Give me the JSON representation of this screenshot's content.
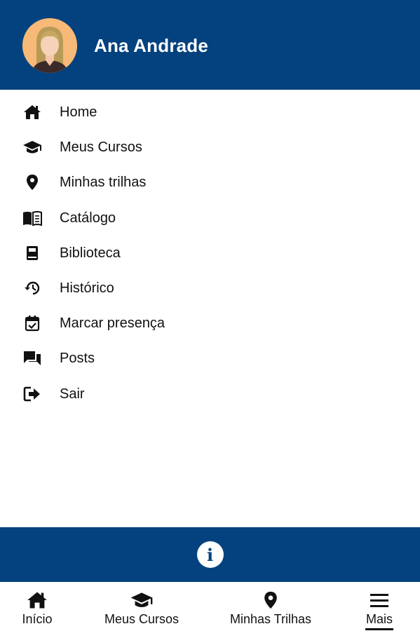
{
  "header": {
    "user_name": "Ana Andrade",
    "background_color": "#03427e",
    "avatar": "avatar-woman-blonde"
  },
  "menu": {
    "items": [
      {
        "label": "Home",
        "icon": "home-icon"
      },
      {
        "label": "Meus Cursos",
        "icon": "graduation-cap-icon"
      },
      {
        "label": "Minhas trilhas",
        "icon": "map-pin-icon"
      },
      {
        "label": "Catálogo",
        "icon": "open-book-icon"
      },
      {
        "label": "Biblioteca",
        "icon": "book-icon"
      },
      {
        "label": "Histórico",
        "icon": "history-icon"
      },
      {
        "label": "Marcar presença",
        "icon": "calendar-check-icon"
      },
      {
        "label": "Posts",
        "icon": "chat-icon"
      },
      {
        "label": "Sair",
        "icon": "logout-icon"
      }
    ]
  },
  "info_bar": {
    "icon": "info-icon",
    "glyph": "i"
  },
  "bottom_nav": {
    "items": [
      {
        "label": "Início",
        "icon": "home-icon",
        "active": false
      },
      {
        "label": "Meus Cursos",
        "icon": "graduation-cap-icon",
        "active": false
      },
      {
        "label": "Minhas Trilhas",
        "icon": "map-pin-icon",
        "active": false
      },
      {
        "label": "Mais",
        "icon": "hamburger-menu-icon",
        "active": true
      }
    ]
  }
}
